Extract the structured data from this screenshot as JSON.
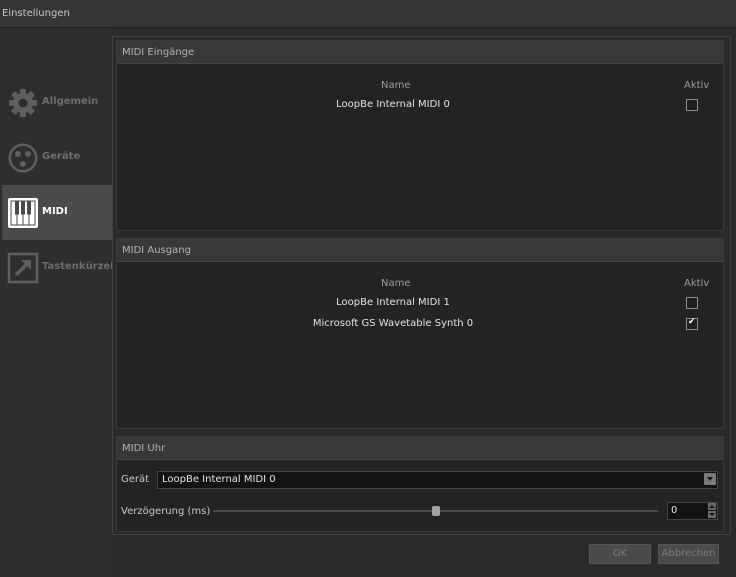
{
  "window": {
    "title": "Einstellungen"
  },
  "sidebar": {
    "items": [
      {
        "label": "Allgemein",
        "icon": "gear-icon",
        "active": false
      },
      {
        "label": "Geräte",
        "icon": "devices-icon",
        "active": false
      },
      {
        "label": "MIDI",
        "icon": "piano-keys-icon",
        "active": true
      },
      {
        "label": "Tastenkürzel",
        "icon": "shortcut-arrow-icon",
        "active": false
      }
    ]
  },
  "midi_inputs": {
    "title": "MIDI Eingänge",
    "col_name": "Name",
    "col_active": "Aktiv",
    "rows": [
      {
        "name": "LoopBe Internal MIDI 0",
        "active": false
      }
    ]
  },
  "midi_outputs": {
    "title": "MIDI Ausgang",
    "col_name": "Name",
    "col_active": "Aktiv",
    "rows": [
      {
        "name": "LoopBe Internal MIDI 1",
        "active": false
      },
      {
        "name": "Microsoft GS Wavetable Synth 0",
        "active": true
      }
    ]
  },
  "midi_clock": {
    "title": "MIDI Uhr",
    "device_label": "Gerät",
    "device_value": "LoopBe Internal MIDI 0",
    "delay_label": "Verzögerung (ms)",
    "delay_value": "0",
    "slider_level": 0.5
  },
  "buttons": {
    "ok": "OK",
    "cancel": "Abbrechen"
  }
}
